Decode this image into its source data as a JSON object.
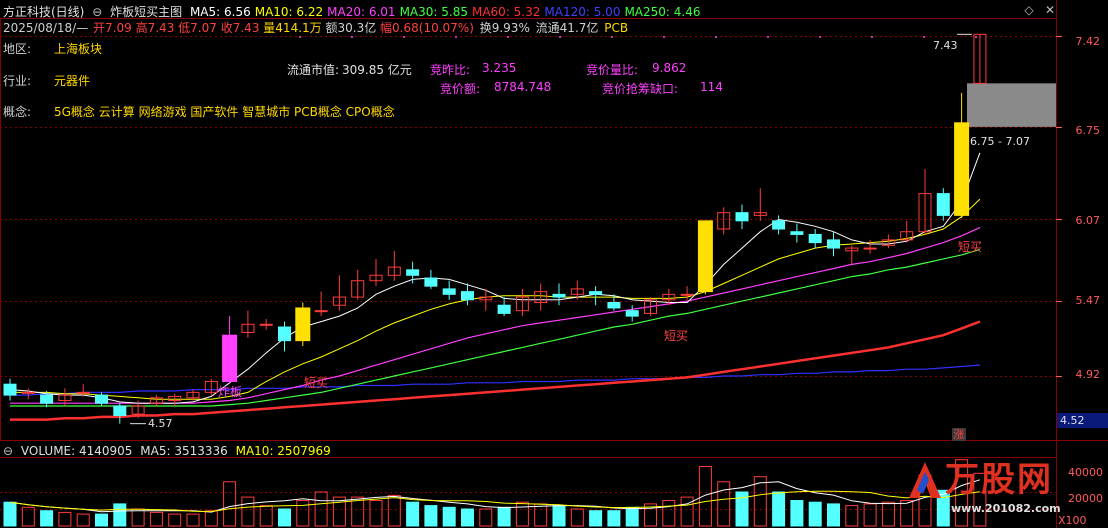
{
  "header": {
    "title": "方正科技(日线)",
    "indicator_name": "炸板短买主图",
    "ma": [
      {
        "label": "MA5: 6.56",
        "color": "#ffffff"
      },
      {
        "label": "MA10: 6.22",
        "color": "#ffff00"
      },
      {
        "label": "MA20: 6.01",
        "color": "#ff40ff"
      },
      {
        "label": "MA30: 5.85",
        "color": "#40ff40"
      },
      {
        "label": "MA60: 5.32",
        "color": "#ff3030"
      },
      {
        "label": "MA120: 5.00",
        "color": "#4040ff"
      },
      {
        "label": "MA250: 4.46",
        "color": "#40ff40"
      }
    ],
    "date": "2025/08/18/—",
    "open": "开7.09",
    "high": "高7.43",
    "low": "低7.07",
    "close": "收7.43",
    "volume": "量414.1万",
    "amount": "额30.3亿",
    "change": "幅0.68(10.07%)",
    "turnover": "换9.93%",
    "float": "流通41.7亿",
    "tag": "PCB"
  },
  "info": {
    "region_label": "地区:",
    "region": "上海板块",
    "industry_label": "行业:",
    "industry": "元器件",
    "concept_label": "概念:",
    "concept": "5G概念 云计算 网络游戏 国产软件 智慧城市 PCB概念 CPO概念",
    "float_mv_label": "流通市值:",
    "float_mv": "309.85 亿元",
    "bid_ratio_label": "竞昨比:",
    "bid_ratio": "3.235",
    "bid_amount_label": "竞价额:",
    "bid_amount": "8784.748",
    "bid_vol_ratio_label": "竞价量比:",
    "bid_vol_ratio": "9.862",
    "bid_gap_label": "竞价抢筹缺口:",
    "bid_gap": "114"
  },
  "annotations": {
    "zhaban": "炸板",
    "duanmai1": "短买",
    "duanmai2": "短买",
    "duanmai3": "短买",
    "low_price": "4.57",
    "high_price": "7.43",
    "gap_range": "6.75 - 7.07",
    "limit_up": "涨"
  },
  "price_axis": {
    "labels": [
      "7.42",
      "6.75",
      "6.07",
      "5.47",
      "4.92"
    ],
    "current": "4.52"
  },
  "volume_panel": {
    "title": "VOLUME: 4140905",
    "ma5": "MA5: 3513336",
    "ma10": "MA10: 2507969",
    "axis_labels": [
      "40000",
      "20000"
    ],
    "unit": "X100"
  },
  "watermark": {
    "brand": "万股网",
    "url": "www.201082.com"
  },
  "colors": {
    "up": "#ff3b3b",
    "down": "#54ffff",
    "grid": "#8a0000",
    "ma5": "#ffffff",
    "ma10": "#ffff00",
    "ma20": "#ff40ff",
    "ma30": "#40ff40",
    "ma60": "#ff3030",
    "ma120": "#3030ff"
  },
  "chart_data": {
    "type": "candlestick",
    "candles": [
      [
        4.86,
        4.78,
        4.9,
        4.74
      ],
      [
        4.8,
        4.8,
        4.83,
        4.75
      ],
      [
        4.78,
        4.72,
        4.81,
        4.69
      ],
      [
        4.74,
        4.78,
        4.83,
        4.7
      ],
      [
        4.8,
        4.8,
        4.86,
        4.77
      ],
      [
        4.78,
        4.72,
        4.8,
        4.7
      ],
      [
        4.7,
        4.63,
        4.72,
        4.57
      ],
      [
        4.64,
        4.7,
        4.74,
        4.61
      ],
      [
        4.72,
        4.76,
        4.78,
        4.7
      ],
      [
        4.74,
        4.77,
        4.79,
        4.7
      ],
      [
        4.76,
        4.8,
        4.82,
        4.74
      ],
      [
        4.8,
        4.88,
        4.9,
        4.78
      ],
      [
        4.88,
        5.22,
        5.36,
        4.86
      ],
      [
        5.24,
        5.3,
        5.4,
        5.2
      ],
      [
        5.3,
        5.3,
        5.34,
        5.26
      ],
      [
        5.28,
        5.18,
        5.32,
        5.1
      ],
      [
        5.18,
        5.42,
        5.46,
        5.14
      ],
      [
        5.4,
        5.4,
        5.54,
        5.36
      ],
      [
        5.44,
        5.5,
        5.66,
        5.4
      ],
      [
        5.5,
        5.62,
        5.7,
        5.48
      ],
      [
        5.62,
        5.66,
        5.78,
        5.58
      ],
      [
        5.66,
        5.72,
        5.84,
        5.62
      ],
      [
        5.7,
        5.66,
        5.76,
        5.6
      ],
      [
        5.64,
        5.58,
        5.7,
        5.56
      ],
      [
        5.56,
        5.52,
        5.62,
        5.48
      ],
      [
        5.54,
        5.48,
        5.6,
        5.44
      ],
      [
        5.48,
        5.5,
        5.56,
        5.4
      ],
      [
        5.44,
        5.38,
        5.5,
        5.36
      ],
      [
        5.4,
        5.5,
        5.56,
        5.36
      ],
      [
        5.46,
        5.54,
        5.6,
        5.4
      ],
      [
        5.52,
        5.5,
        5.6,
        5.44
      ],
      [
        5.52,
        5.56,
        5.62,
        5.48
      ],
      [
        5.54,
        5.52,
        5.58,
        5.44
      ],
      [
        5.46,
        5.42,
        5.52,
        5.4
      ],
      [
        5.4,
        5.36,
        5.44,
        5.32
      ],
      [
        5.38,
        5.48,
        5.5,
        5.36
      ],
      [
        5.48,
        5.52,
        5.56,
        5.44
      ],
      [
        5.52,
        5.52,
        5.58,
        5.48
      ],
      [
        5.54,
        6.06,
        6.06,
        5.52
      ],
      [
        6.0,
        6.12,
        6.16,
        5.96
      ],
      [
        6.12,
        6.06,
        6.18,
        6.0
      ],
      [
        6.1,
        6.12,
        6.3,
        6.06
      ],
      [
        6.06,
        6.0,
        6.1,
        5.96
      ],
      [
        5.98,
        5.96,
        6.04,
        5.9
      ],
      [
        5.96,
        5.9,
        6.0,
        5.86
      ],
      [
        5.92,
        5.86,
        5.98,
        5.8
      ],
      [
        5.84,
        5.86,
        5.88,
        5.74
      ],
      [
        5.86,
        5.86,
        5.92,
        5.82
      ],
      [
        5.88,
        5.92,
        5.96,
        5.86
      ],
      [
        5.92,
        5.98,
        6.06,
        5.9
      ],
      [
        5.98,
        6.26,
        6.44,
        5.96
      ],
      [
        6.26,
        6.1,
        6.3,
        6.06
      ],
      [
        6.1,
        6.78,
        7.0,
        6.08
      ],
      [
        7.07,
        7.43,
        7.43,
        7.07
      ]
    ],
    "zhaban_index": 12,
    "duanmai_indices": [
      16,
      38,
      52
    ],
    "ma5": [
      4.82,
      4.81,
      4.79,
      4.78,
      4.78,
      4.76,
      4.73,
      4.72,
      4.72,
      4.72,
      4.73,
      4.77,
      4.87,
      4.97,
      5.09,
      5.2,
      5.28,
      5.32,
      5.36,
      5.42,
      5.52,
      5.58,
      5.63,
      5.64,
      5.63,
      5.59,
      5.55,
      5.49,
      5.48,
      5.48,
      5.48,
      5.5,
      5.52,
      5.51,
      5.48,
      5.47,
      5.46,
      5.46,
      5.59,
      5.74,
      5.86,
      5.98,
      6.07,
      6.05,
      6.02,
      5.98,
      5.92,
      5.89,
      5.89,
      5.91,
      5.98,
      6.02,
      6.2,
      6.56
    ],
    "ma10": [
      4.8,
      4.8,
      4.8,
      4.79,
      4.79,
      4.78,
      4.77,
      4.76,
      4.75,
      4.75,
      4.75,
      4.75,
      4.77,
      4.8,
      4.88,
      4.95,
      5.01,
      5.06,
      5.12,
      5.18,
      5.25,
      5.31,
      5.36,
      5.41,
      5.45,
      5.48,
      5.5,
      5.51,
      5.51,
      5.51,
      5.5,
      5.5,
      5.5,
      5.5,
      5.49,
      5.49,
      5.49,
      5.5,
      5.54,
      5.6,
      5.66,
      5.72,
      5.78,
      5.82,
      5.86,
      5.88,
      5.89,
      5.9,
      5.91,
      5.93,
      5.96,
      6.0,
      6.09,
      6.22
    ],
    "ma20": [
      4.72,
      4.72,
      4.72,
      4.72,
      4.72,
      4.72,
      4.72,
      4.72,
      4.72,
      4.72,
      4.72,
      4.73,
      4.74,
      4.76,
      4.79,
      4.82,
      4.85,
      4.89,
      4.92,
      4.96,
      5.0,
      5.04,
      5.08,
      5.12,
      5.16,
      5.2,
      5.23,
      5.26,
      5.29,
      5.31,
      5.33,
      5.35,
      5.37,
      5.39,
      5.41,
      5.43,
      5.45,
      5.47,
      5.5,
      5.53,
      5.56,
      5.59,
      5.62,
      5.65,
      5.68,
      5.71,
      5.74,
      5.76,
      5.79,
      5.82,
      5.86,
      5.9,
      5.95,
      6.01
    ],
    "ma30": [
      4.7,
      4.7,
      4.7,
      4.7,
      4.7,
      4.7,
      4.7,
      4.7,
      4.7,
      4.7,
      4.7,
      4.7,
      4.71,
      4.72,
      4.74,
      4.76,
      4.78,
      4.8,
      4.83,
      4.86,
      4.89,
      4.92,
      4.95,
      4.98,
      5.01,
      5.04,
      5.07,
      5.1,
      5.13,
      5.16,
      5.19,
      5.22,
      5.25,
      5.28,
      5.3,
      5.33,
      5.36,
      5.38,
      5.41,
      5.44,
      5.47,
      5.5,
      5.53,
      5.56,
      5.59,
      5.62,
      5.65,
      5.67,
      5.7,
      5.72,
      5.75,
      5.78,
      5.81,
      5.85
    ],
    "ma60": [
      4.6,
      4.6,
      4.6,
      4.61,
      4.61,
      4.62,
      4.62,
      4.63,
      4.63,
      4.64,
      4.64,
      4.65,
      4.66,
      4.67,
      4.68,
      4.69,
      4.7,
      4.71,
      4.72,
      4.73,
      4.74,
      4.75,
      4.76,
      4.77,
      4.78,
      4.79,
      4.8,
      4.81,
      4.82,
      4.83,
      4.84,
      4.85,
      4.86,
      4.87,
      4.88,
      4.89,
      4.9,
      4.91,
      4.93,
      4.95,
      4.97,
      4.99,
      5.01,
      5.03,
      5.05,
      5.07,
      5.09,
      5.11,
      5.13,
      5.16,
      5.19,
      5.22,
      5.27,
      5.32
    ],
    "ma120": [
      4.78,
      4.78,
      4.79,
      4.79,
      4.8,
      4.8,
      4.8,
      4.81,
      4.81,
      4.81,
      4.82,
      4.82,
      4.82,
      4.83,
      4.83,
      4.83,
      4.84,
      4.84,
      4.84,
      4.85,
      4.85,
      4.85,
      4.86,
      4.86,
      4.86,
      4.87,
      4.87,
      4.87,
      4.88,
      4.88,
      4.88,
      4.89,
      4.89,
      4.89,
      4.9,
      4.9,
      4.9,
      4.91,
      4.91,
      4.92,
      4.92,
      4.93,
      4.93,
      4.94,
      4.94,
      4.95,
      4.95,
      4.96,
      4.96,
      4.97,
      4.97,
      4.98,
      4.99,
      5.0
    ],
    "volume": [
      28,
      22,
      18,
      16,
      14,
      14,
      26,
      20,
      16,
      14,
      14,
      18,
      52,
      34,
      24,
      20,
      30,
      40,
      34,
      34,
      30,
      36,
      28,
      24,
      22,
      20,
      20,
      22,
      28,
      26,
      24,
      20,
      18,
      18,
      22,
      26,
      30,
      34,
      70,
      52,
      40,
      58,
      40,
      30,
      28,
      26,
      24,
      26,
      28,
      30,
      60,
      42,
      78,
      62
    ],
    "price_range": [
      4.45,
      7.55
    ],
    "volume_max": 80
  }
}
